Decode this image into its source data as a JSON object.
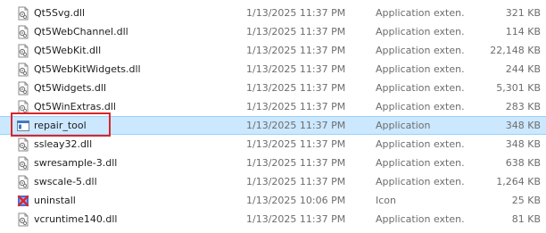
{
  "files": [
    {
      "name": "Qt5Svg.dll",
      "date": "1/13/2025 11:37 PM",
      "type": "Application exten...",
      "size": "321 KB",
      "icon": "dll-file-icon"
    },
    {
      "name": "Qt5WebChannel.dll",
      "date": "1/13/2025 11:37 PM",
      "type": "Application exten...",
      "size": "114 KB",
      "icon": "dll-file-icon"
    },
    {
      "name": "Qt5WebKit.dll",
      "date": "1/13/2025 11:37 PM",
      "type": "Application exten...",
      "size": "22,148 KB",
      "icon": "dll-file-icon"
    },
    {
      "name": "Qt5WebKitWidgets.dll",
      "date": "1/13/2025 11:37 PM",
      "type": "Application exten...",
      "size": "244 KB",
      "icon": "dll-file-icon"
    },
    {
      "name": "Qt5Widgets.dll",
      "date": "1/13/2025 11:37 PM",
      "type": "Application exten...",
      "size": "5,301 KB",
      "icon": "dll-file-icon"
    },
    {
      "name": "Qt5WinExtras.dll",
      "date": "1/13/2025 11:37 PM",
      "type": "Application exten...",
      "size": "283 KB",
      "icon": "dll-file-icon"
    },
    {
      "name": "repair_tool",
      "date": "1/13/2025 11:37 PM",
      "type": "Application",
      "size": "348 KB",
      "icon": "application-icon",
      "selected": true
    },
    {
      "name": "ssleay32.dll",
      "date": "1/13/2025 11:37 PM",
      "type": "Application exten...",
      "size": "348 KB",
      "icon": "dll-file-icon"
    },
    {
      "name": "swresample-3.dll",
      "date": "1/13/2025 11:37 PM",
      "type": "Application exten...",
      "size": "638 KB",
      "icon": "dll-file-icon"
    },
    {
      "name": "swscale-5.dll",
      "date": "1/13/2025 11:37 PM",
      "type": "Application exten...",
      "size": "1,264 KB",
      "icon": "dll-file-icon"
    },
    {
      "name": "uninstall",
      "date": "1/13/2025 10:06 PM",
      "type": "Icon",
      "size": "25 KB",
      "icon": "uninstall-icon"
    },
    {
      "name": "vcruntime140.dll",
      "date": "1/13/2025 11:37 PM",
      "type": "Application exten...",
      "size": "81 KB",
      "icon": "dll-file-icon"
    }
  ],
  "colors": {
    "selection_bg": "#cce8ff",
    "selection_border": "#99d1ff",
    "highlight_box": "#d9252b",
    "secondary_text": "#6d6d6d"
  }
}
